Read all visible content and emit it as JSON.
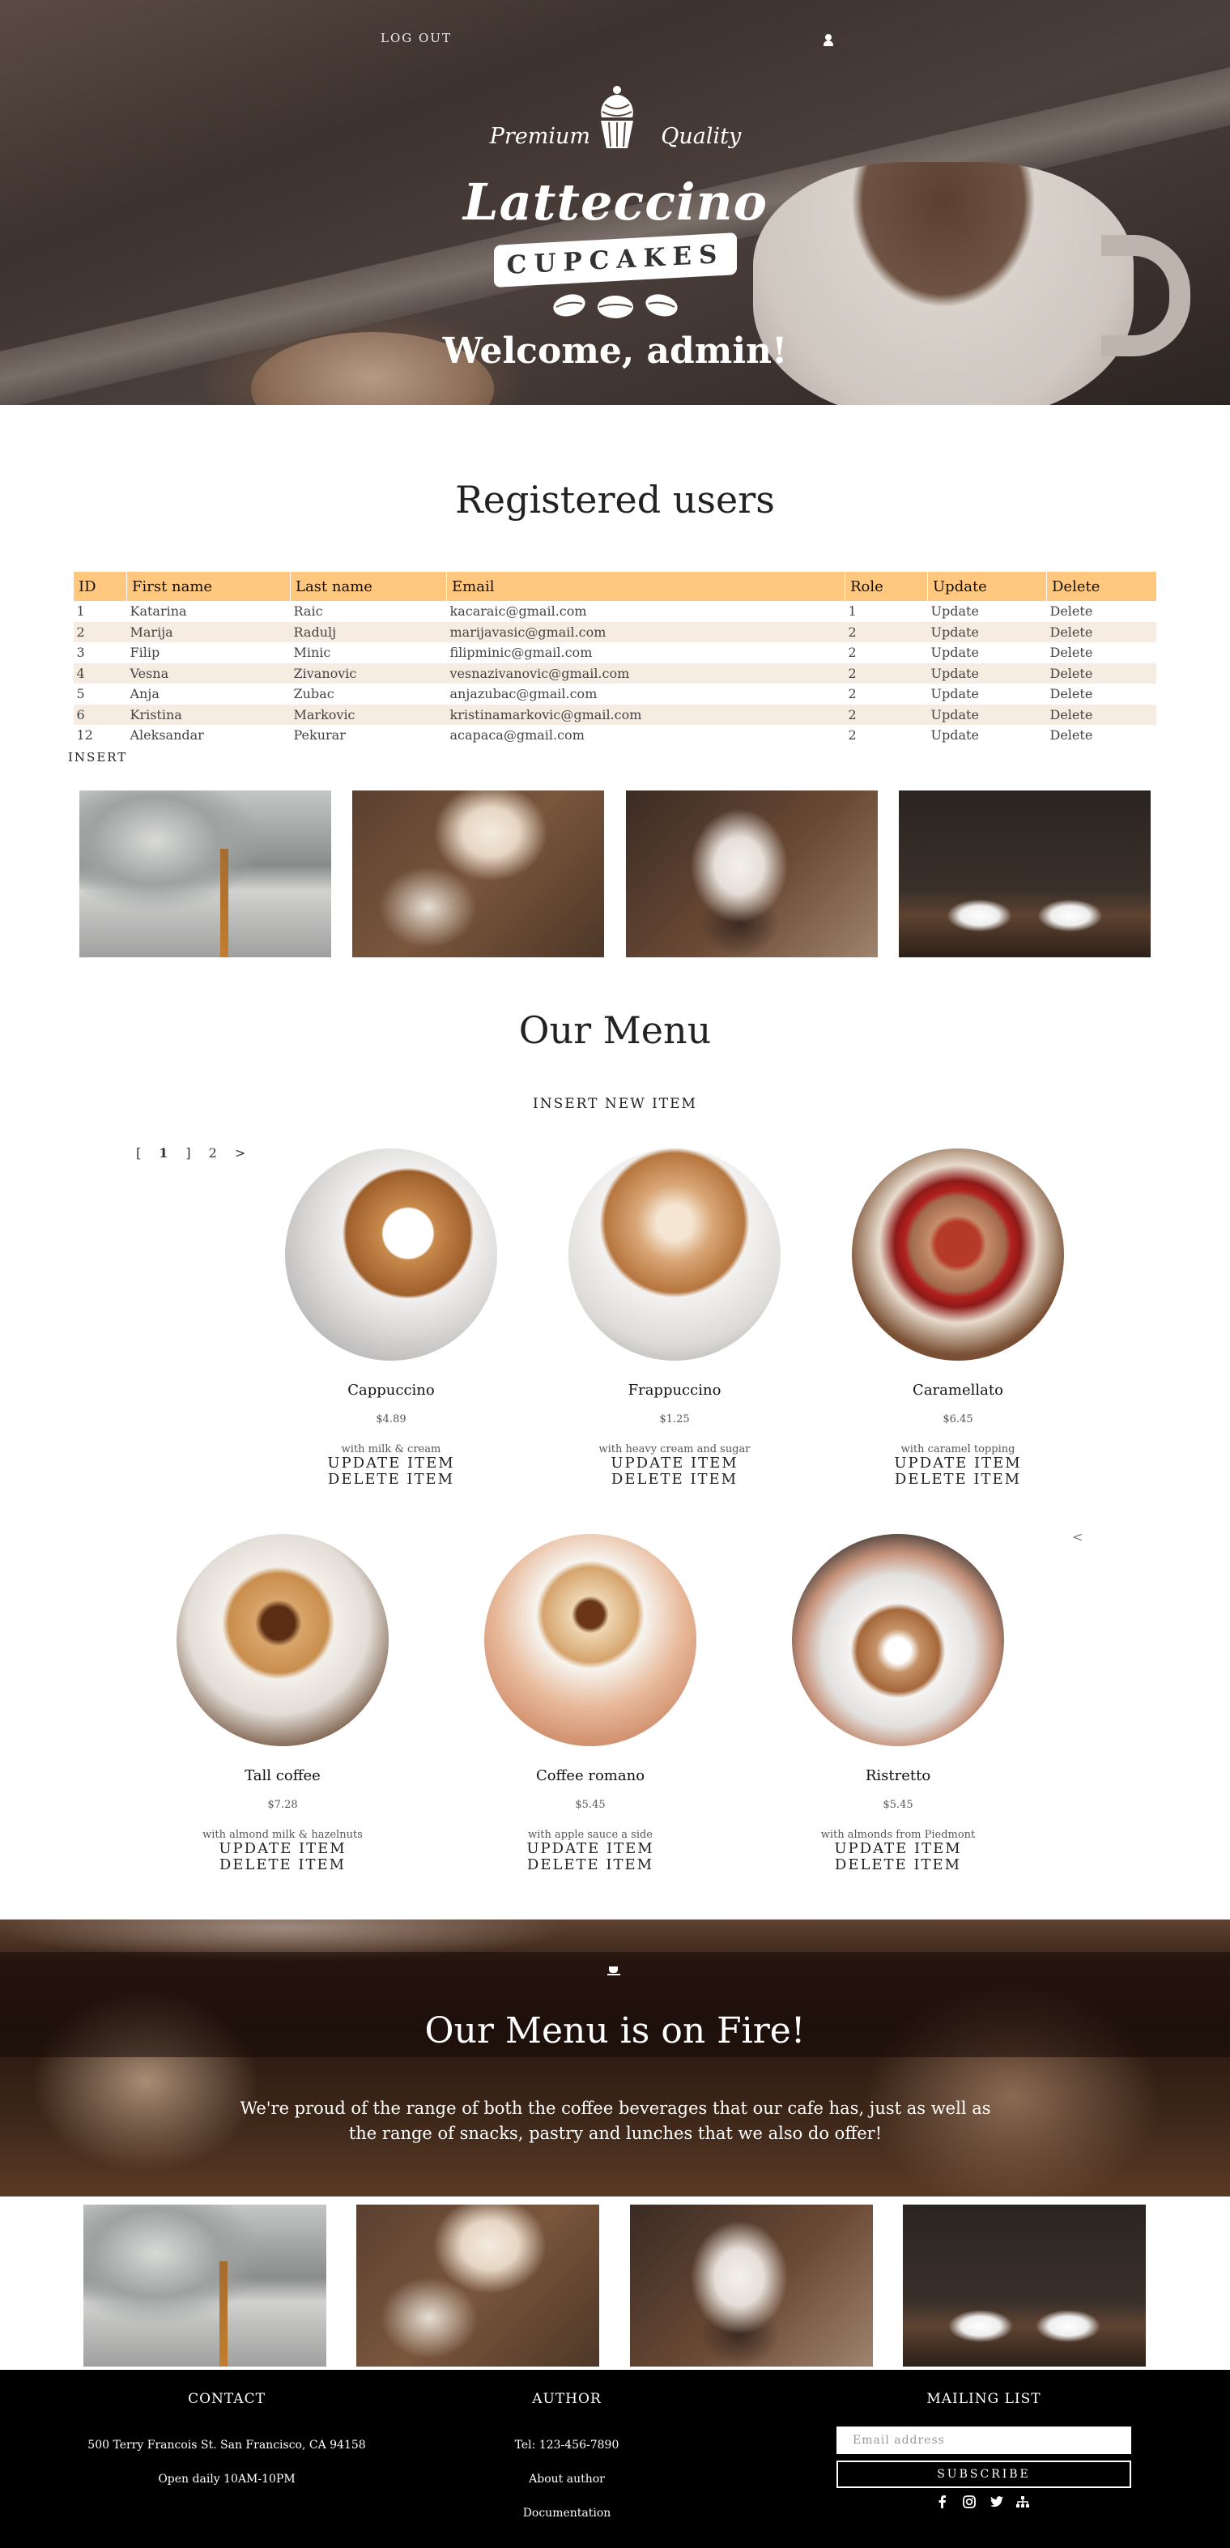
{
  "header": {
    "logout_label": "LOG OUT",
    "logo": {
      "premium_left": "Premium",
      "premium_right": "Quality",
      "brand": "Latteccino",
      "banner": "CUPCAKES"
    },
    "welcome": "Welcome, admin!"
  },
  "users": {
    "title": "Registered users",
    "columns": [
      "ID",
      "First name",
      "Last name",
      "Email",
      "Role",
      "Update",
      "Delete"
    ],
    "rows": [
      {
        "id": "1",
        "first": "Katarina",
        "last": "Raic",
        "email": "kacaraic@gmail.com",
        "role": "1",
        "update": "Update",
        "delete": "Delete"
      },
      {
        "id": "2",
        "first": "Marija",
        "last": "Radulj",
        "email": "marijavasic@gmail.com",
        "role": "2",
        "update": "Update",
        "delete": "Delete"
      },
      {
        "id": "3",
        "first": "Filip",
        "last": "Minic",
        "email": "filipminic@gmail.com",
        "role": "2",
        "update": "Update",
        "delete": "Delete"
      },
      {
        "id": "4",
        "first": "Vesna",
        "last": "Zivanovic",
        "email": "vesnazivanovic@gmail.com",
        "role": "2",
        "update": "Update",
        "delete": "Delete"
      },
      {
        "id": "5",
        "first": "Anja",
        "last": "Zubac",
        "email": "anjazubac@gmail.com",
        "role": "2",
        "update": "Update",
        "delete": "Delete"
      },
      {
        "id": "6",
        "first": "Kristina",
        "last": "Markovic",
        "email": "kristinamarkovic@gmail.com",
        "role": "2",
        "update": "Update",
        "delete": "Delete"
      },
      {
        "id": "12",
        "first": "Aleksandar",
        "last": "Pekurar",
        "email": "acapaca@gmail.com",
        "role": "2",
        "update": "Update",
        "delete": "Delete"
      }
    ],
    "insert_label": "INSERT"
  },
  "menu": {
    "title": "Our Menu",
    "insert_label": "INSERT NEW ITEM",
    "pagination": [
      "[",
      "1",
      "]",
      "2",
      ">"
    ],
    "prev_label": "<",
    "update_label": "UPDATE ITEM",
    "delete_label": "DELETE ITEM",
    "items": [
      {
        "name": "Cappuccino",
        "price": "$4.89",
        "desc": "with milk & cream"
      },
      {
        "name": "Frappuccino",
        "price": "$1.25",
        "desc": "with heavy cream and sugar"
      },
      {
        "name": "Caramellato",
        "price": "$6.45",
        "desc": "with caramel topping"
      },
      {
        "name": "Tall coffee",
        "price": "$7.28",
        "desc": "with almond milk & hazelnuts"
      },
      {
        "name": "Coffee romano",
        "price": "$5.45",
        "desc": "with apple sauce a side"
      },
      {
        "name": "Ristretto",
        "price": "$5.45",
        "desc": "with almonds from Piedmont"
      }
    ]
  },
  "fire": {
    "title": "Our Menu is on Fire!",
    "text": "We're proud of the range of both the coffee beverages that our cafe has, just as well as the range of snacks, pastry and lunches that we also do offer!"
  },
  "footer": {
    "contact": {
      "title": "CONTACT",
      "address": "500 Terry Francois St. San Francisco, CA 94158",
      "hours": "Open daily 10AM-10PM"
    },
    "author": {
      "title": "AUTHOR",
      "tel": "Tel: 123-456-7890",
      "about": "About author",
      "docs": "Documentation"
    },
    "mailing": {
      "title": "MAILING LIST",
      "placeholder": "Email address",
      "subscribe": "SUBSCRIBE"
    },
    "social_icons": [
      "facebook-icon",
      "instagram-icon",
      "twitter-icon",
      "sitemap-icon"
    ]
  }
}
